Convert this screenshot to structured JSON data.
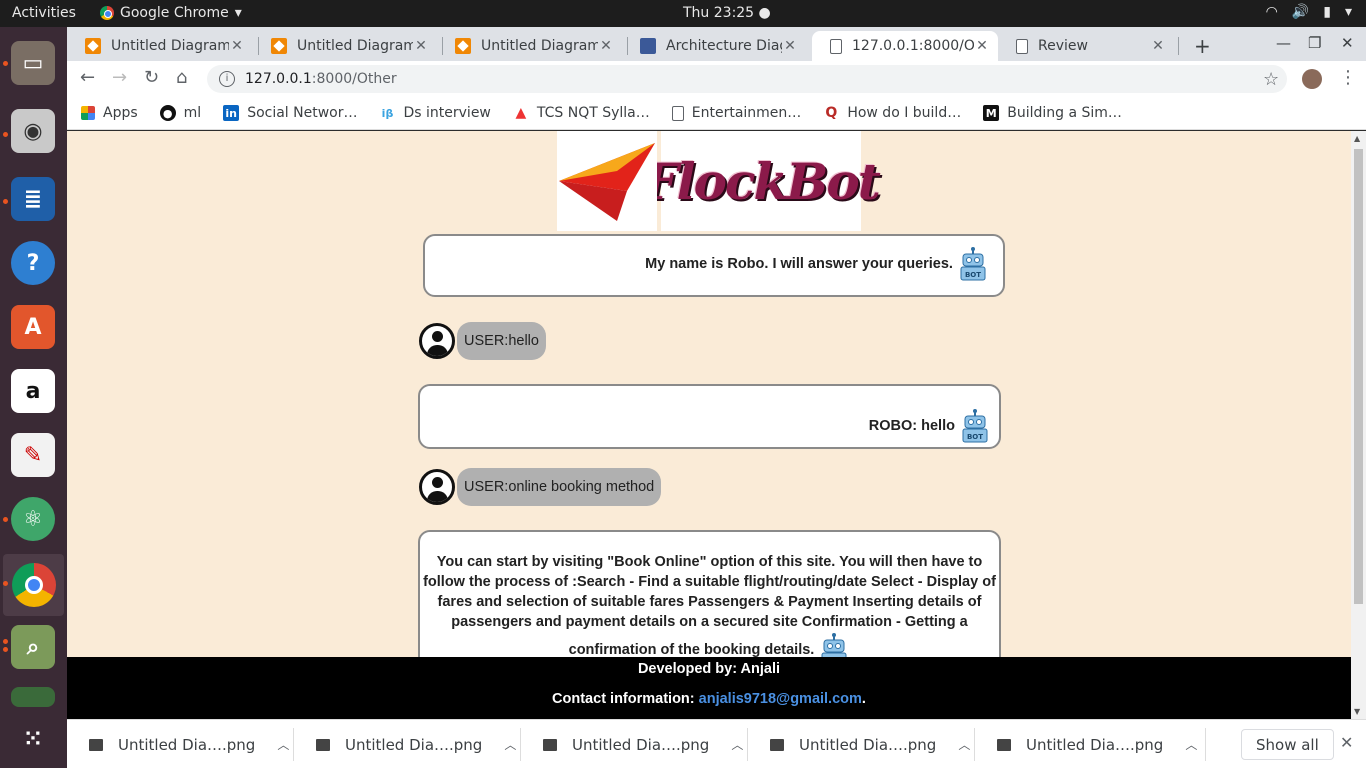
{
  "system": {
    "activities": "Activities",
    "app_name": "Google Chrome",
    "clock": "Thu 23:25 ●"
  },
  "tabs": [
    {
      "title": "Untitled Diagram.",
      "icon": "drawio-icon"
    },
    {
      "title": "Untitled Diagram",
      "icon": "drawio-icon"
    },
    {
      "title": "Untitled Diagram",
      "icon": "drawio-icon"
    },
    {
      "title": "Architecture Diag",
      "icon": "docs-icon"
    },
    {
      "title": "127.0.0.1:8000/Ot",
      "icon": "page-icon",
      "active": true
    },
    {
      "title": "Review",
      "icon": "page-icon"
    }
  ],
  "address": {
    "host": "127.0.0.1",
    "path": ":8000/Other"
  },
  "bookmarks": [
    {
      "label": "Apps",
      "icon": "apps-grid-icon"
    },
    {
      "label": "ml",
      "icon": "github-icon"
    },
    {
      "label": "Social Networ…",
      "icon": "linkedin-icon"
    },
    {
      "label": "Ds interview",
      "icon": "interviewbit-icon"
    },
    {
      "label": "TCS NQT Sylla…",
      "icon": "prepinsta-icon"
    },
    {
      "label": "Entertainmen…",
      "icon": "page-icon"
    },
    {
      "label": "How do I build…",
      "icon": "quora-icon"
    },
    {
      "label": "Building a Sim…",
      "icon": "medium-icon"
    }
  ],
  "page": {
    "logo_text": "FlockBot",
    "welcome": "My name is Robo. I will answer your queries.",
    "user_msg_1": "USER:hello",
    "bot_reply_1": "ROBO: hello",
    "user_msg_2": "USER:online booking method",
    "bot_reply_2": "You can start by visiting \"Book Online\" option of this site. You will then have to follow the process of :Search - Find a suitable flight/routing/date Select - Display of fares and selection of suitable fares Passengers & Payment Inserting details of passengers and payment details on a secured site Confirmation - Getting a confirmation of the booking details.",
    "footer_dev": "Developed by: Anjali",
    "footer_contact_label": "Contact information:",
    "footer_email": "anjalis9718@gmail.com",
    "footer_period": "."
  },
  "downloads": [
    {
      "name": "Untitled Dia….png"
    },
    {
      "name": "Untitled Dia….png"
    },
    {
      "name": "Untitled Dia….png"
    },
    {
      "name": "Untitled Dia….png"
    },
    {
      "name": "Untitled Dia….png"
    }
  ],
  "show_all": "Show all",
  "colors": {
    "page_bg": "#faebd7",
    "footer_bg": "#000000",
    "link": "#4a90e2",
    "user_bubble": "#b0b0b0"
  }
}
